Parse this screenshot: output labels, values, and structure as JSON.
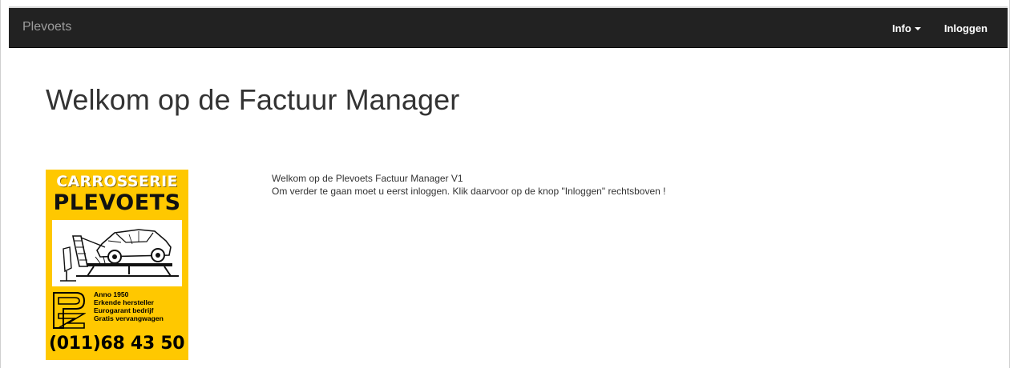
{
  "navbar": {
    "brand": "Plevoets",
    "items": [
      {
        "label": "Info",
        "has_caret": true
      },
      {
        "label": "Inloggen",
        "has_caret": false
      }
    ],
    "background": "#222222",
    "brand_color": "#9d9d9d"
  },
  "main": {
    "title": "Welkom op de Factuur Manager",
    "intro_lines": [
      "Welkom op de Plevoets Factuur Manager V1",
      "Om verder te gaan moet u eerst inloggen. Klik daarvoor op de knop \"Inloggen\" rechtsboven !"
    ]
  },
  "logo": {
    "line1": "CARROSSERIE",
    "line2": "PLEVOETS",
    "facts": [
      "Anno 1950",
      "Erkende hersteller",
      "Eurogarant bedrijf",
      "Gratis vervangwagen"
    ],
    "phone": "(011)68 43 50",
    "background": "#ffc800"
  }
}
